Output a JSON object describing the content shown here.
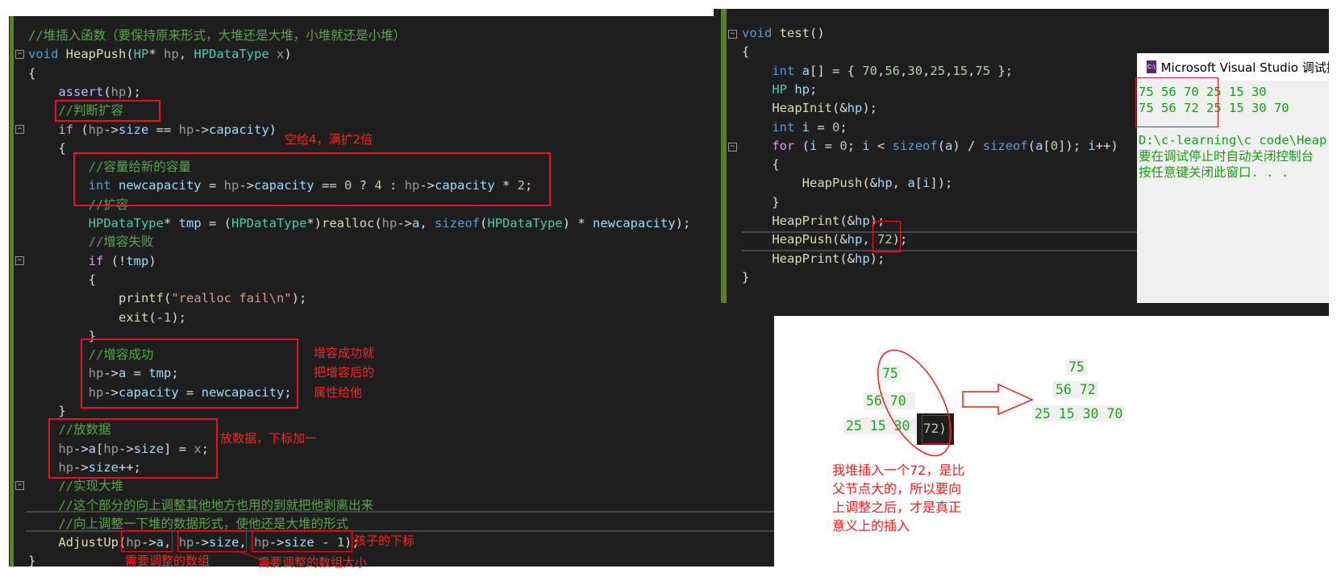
{
  "left_editor": {
    "lines": [
      [
        [
          "cm",
          "//堆插入函数（要保持原来形式，大堆还是大堆，小堆就还是小堆）"
        ]
      ],
      [
        [
          "kw",
          "void "
        ],
        [
          "fn",
          "HeapPush"
        ],
        [
          "pl",
          "("
        ],
        [
          "ty",
          "HP"
        ],
        [
          "pl",
          "* "
        ],
        [
          "pa",
          "hp"
        ],
        [
          "pl",
          ", "
        ],
        [
          "ty",
          "HPDataType "
        ],
        [
          "pa",
          "x"
        ],
        [
          "pl",
          ")"
        ]
      ],
      [
        [
          "pl",
          "{"
        ]
      ],
      [
        [
          "pl",
          "    "
        ],
        [
          "ma",
          "assert"
        ],
        [
          "pl",
          "("
        ],
        [
          "pa",
          "hp"
        ],
        [
          "pl",
          ");"
        ]
      ],
      [
        [
          "pl",
          "    "
        ],
        [
          "cm",
          "//判断扩容"
        ]
      ],
      [
        [
          "pl",
          "    "
        ],
        [
          "ct",
          "if "
        ],
        [
          "pl",
          "("
        ],
        [
          "pa",
          "hp"
        ],
        [
          "pl",
          "->"
        ],
        [
          "va",
          "size"
        ],
        [
          "pl",
          " == "
        ],
        [
          "pa",
          "hp"
        ],
        [
          "pl",
          "->"
        ],
        [
          "va",
          "capacity"
        ],
        [
          "pl",
          ")"
        ]
      ],
      [
        [
          "pl",
          "    {"
        ]
      ],
      [
        [
          "pl",
          "        "
        ],
        [
          "cm",
          "//容量给新的容量"
        ]
      ],
      [
        [
          "pl",
          "        "
        ],
        [
          "kw",
          "int "
        ],
        [
          "va",
          "newcapacity"
        ],
        [
          "pl",
          " = "
        ],
        [
          "pa",
          "hp"
        ],
        [
          "pl",
          "->"
        ],
        [
          "va",
          "capacity"
        ],
        [
          "pl",
          " == "
        ],
        [
          "nu",
          "0"
        ],
        [
          "pl",
          " ? "
        ],
        [
          "nu",
          "4"
        ],
        [
          "pl",
          " : "
        ],
        [
          "pa",
          "hp"
        ],
        [
          "pl",
          "->"
        ],
        [
          "va",
          "capacity"
        ],
        [
          "pl",
          " * "
        ],
        [
          "nu",
          "2"
        ],
        [
          "pl",
          ";"
        ]
      ],
      [
        [
          "pl",
          "        "
        ],
        [
          "cm",
          "//扩容"
        ]
      ],
      [
        [
          "pl",
          "        "
        ],
        [
          "ty",
          "HPDataType"
        ],
        [
          "pl",
          "* "
        ],
        [
          "va",
          "tmp"
        ],
        [
          "pl",
          " = ("
        ],
        [
          "ty",
          "HPDataType"
        ],
        [
          "pl",
          "*)"
        ],
        [
          "fn",
          "realloc"
        ],
        [
          "pl",
          "("
        ],
        [
          "pa",
          "hp"
        ],
        [
          "pl",
          "->"
        ],
        [
          "va",
          "a"
        ],
        [
          "pl",
          ", "
        ],
        [
          "kw",
          "sizeof"
        ],
        [
          "pl",
          "("
        ],
        [
          "ty",
          "HPDataType"
        ],
        [
          "pl",
          ") * "
        ],
        [
          "va",
          "newcapacity"
        ],
        [
          "pl",
          ");"
        ]
      ],
      [
        [
          "pl",
          "        "
        ],
        [
          "cm",
          "//增容失败"
        ]
      ],
      [
        [
          "pl",
          "        "
        ],
        [
          "ct",
          "if "
        ],
        [
          "pl",
          "(!"
        ],
        [
          "va",
          "tmp"
        ],
        [
          "pl",
          ")"
        ]
      ],
      [
        [
          "pl",
          "        {"
        ]
      ],
      [
        [
          "pl",
          "            "
        ],
        [
          "fn",
          "printf"
        ],
        [
          "pl",
          "("
        ],
        [
          "st",
          "\"realloc fail\\n\""
        ],
        [
          "pl",
          ");"
        ]
      ],
      [
        [
          "pl",
          "            "
        ],
        [
          "fn",
          "exit"
        ],
        [
          "pl",
          "(-"
        ],
        [
          "nu",
          "1"
        ],
        [
          "pl",
          ");"
        ]
      ],
      [
        [
          "pl",
          "        }"
        ]
      ],
      [
        [
          "pl",
          "        "
        ],
        [
          "cm",
          "//增容成功"
        ]
      ],
      [
        [
          "pl",
          "        "
        ],
        [
          "pa",
          "hp"
        ],
        [
          "pl",
          "->"
        ],
        [
          "va",
          "a"
        ],
        [
          "pl",
          " = "
        ],
        [
          "va",
          "tmp"
        ],
        [
          "pl",
          ";"
        ]
      ],
      [
        [
          "pl",
          "        "
        ],
        [
          "pa",
          "hp"
        ],
        [
          "pl",
          "->"
        ],
        [
          "va",
          "capacity"
        ],
        [
          "pl",
          " = "
        ],
        [
          "va",
          "newcapacity"
        ],
        [
          "pl",
          ";"
        ]
      ],
      [
        [
          "pl",
          "    }"
        ]
      ],
      [
        [
          "pl",
          "    "
        ],
        [
          "cm",
          "//放数据"
        ]
      ],
      [
        [
          "pl",
          "    "
        ],
        [
          "pa",
          "hp"
        ],
        [
          "pl",
          "->"
        ],
        [
          "va",
          "a"
        ],
        [
          "pl",
          "["
        ],
        [
          "pa",
          "hp"
        ],
        [
          "pl",
          "->"
        ],
        [
          "va",
          "size"
        ],
        [
          "pl",
          "] = "
        ],
        [
          "pa",
          "x"
        ],
        [
          "pl",
          ";"
        ]
      ],
      [
        [
          "pl",
          "    "
        ],
        [
          "pa",
          "hp"
        ],
        [
          "pl",
          "->"
        ],
        [
          "va",
          "size"
        ],
        [
          "pl",
          "++;"
        ]
      ],
      [
        [
          "pl",
          "    "
        ],
        [
          "cm",
          "//实现大堆"
        ]
      ],
      [
        [
          "pl",
          "    "
        ],
        [
          "cm",
          "//这个部分的向上调整其他地方也用的到就把他剥离出来"
        ]
      ],
      [
        [
          "pl",
          "    "
        ],
        [
          "cm",
          "//向上调整一下堆的数据形式，使他还是大堆的形式"
        ]
      ],
      [
        [
          "pl",
          "    "
        ],
        [
          "fn",
          "AdjustUp"
        ],
        [
          "pl",
          "("
        ],
        [
          "pa",
          "hp"
        ],
        [
          "pl",
          "->"
        ],
        [
          "va",
          "a"
        ],
        [
          "pl",
          ", "
        ],
        [
          "pa",
          "hp"
        ],
        [
          "pl",
          "->"
        ],
        [
          "va",
          "size"
        ],
        [
          "pl",
          ", "
        ],
        [
          "pa",
          "hp"
        ],
        [
          "pl",
          "->"
        ],
        [
          "va",
          "size"
        ],
        [
          "pl",
          " - "
        ],
        [
          "nu",
          "1"
        ],
        [
          "pl",
          ");"
        ]
      ],
      [
        [
          "pl",
          "}"
        ]
      ]
    ]
  },
  "right_editor": {
    "lines": [
      [
        [
          "kw",
          "void "
        ],
        [
          "fn",
          "test"
        ],
        [
          "pl",
          "()"
        ]
      ],
      [
        [
          "pl",
          "{"
        ]
      ],
      [
        [
          "pl",
          "    "
        ],
        [
          "kw",
          "int "
        ],
        [
          "va",
          "a"
        ],
        [
          "pl",
          "[] = { "
        ],
        [
          "nu",
          "70"
        ],
        [
          "pl",
          ","
        ],
        [
          "nu",
          "56"
        ],
        [
          "pl",
          ","
        ],
        [
          "nu",
          "30"
        ],
        [
          "pl",
          ","
        ],
        [
          "nu",
          "25"
        ],
        [
          "pl",
          ","
        ],
        [
          "nu",
          "15"
        ],
        [
          "pl",
          ","
        ],
        [
          "nu",
          "75"
        ],
        [
          "pl",
          " };"
        ]
      ],
      [
        [
          "pl",
          "    "
        ],
        [
          "ty",
          "HP "
        ],
        [
          "va",
          "hp"
        ],
        [
          "pl",
          ";"
        ]
      ],
      [
        [
          "pl",
          "    "
        ],
        [
          "fn",
          "HeapInit"
        ],
        [
          "pl",
          "(&"
        ],
        [
          "va",
          "hp"
        ],
        [
          "pl",
          ");"
        ]
      ],
      [
        [
          "pl",
          "    "
        ],
        [
          "kw",
          "int "
        ],
        [
          "va",
          "i"
        ],
        [
          "pl",
          " = "
        ],
        [
          "nu",
          "0"
        ],
        [
          "pl",
          ";"
        ]
      ],
      [
        [
          "pl",
          "    "
        ],
        [
          "ct",
          "for "
        ],
        [
          "pl",
          "("
        ],
        [
          "va",
          "i"
        ],
        [
          "pl",
          " = "
        ],
        [
          "nu",
          "0"
        ],
        [
          "pl",
          "; "
        ],
        [
          "va",
          "i"
        ],
        [
          "pl",
          " < "
        ],
        [
          "kw",
          "sizeof"
        ],
        [
          "pl",
          "("
        ],
        [
          "va",
          "a"
        ],
        [
          "pl",
          ") / "
        ],
        [
          "kw",
          "sizeof"
        ],
        [
          "pl",
          "("
        ],
        [
          "va",
          "a"
        ],
        [
          "pl",
          "["
        ],
        [
          "nu",
          "0"
        ],
        [
          "pl",
          "]); "
        ],
        [
          "va",
          "i"
        ],
        [
          "pl",
          "++)"
        ]
      ],
      [
        [
          "pl",
          "    {"
        ]
      ],
      [
        [
          "pl",
          "        "
        ],
        [
          "fn",
          "HeapPush"
        ],
        [
          "pl",
          "(&"
        ],
        [
          "va",
          "hp"
        ],
        [
          "pl",
          ", "
        ],
        [
          "va",
          "a"
        ],
        [
          "pl",
          "["
        ],
        [
          "va",
          "i"
        ],
        [
          "pl",
          "]);"
        ]
      ],
      [
        [
          "pl",
          "    }"
        ]
      ],
      [
        [
          "pl",
          "    "
        ],
        [
          "fn",
          "HeapPrint"
        ],
        [
          "pl",
          "(&"
        ],
        [
          "va",
          "hp"
        ],
        [
          "pl",
          ");"
        ]
      ],
      [
        [
          "pl",
          "    "
        ],
        [
          "fn",
          "HeapPush"
        ],
        [
          "pl",
          "(&"
        ],
        [
          "va",
          "hp"
        ],
        [
          "pl",
          ", "
        ],
        [
          "nu",
          "72"
        ],
        [
          "pl",
          ");"
        ]
      ],
      [
        [
          "pl",
          "    "
        ],
        [
          "fn",
          "HeapPrint"
        ],
        [
          "pl",
          "(&"
        ],
        [
          "va",
          "hp"
        ],
        [
          "pl",
          ");"
        ]
      ],
      [
        [
          "pl",
          "}"
        ]
      ]
    ]
  },
  "annotations": {
    "expand_rule": "空给4，满扩2倍",
    "assign_after_grow": [
      "增容成功就",
      "把增容后的",
      "属性给他"
    ],
    "put_data": "放数据，下标加一",
    "child_index": "孩子的下标",
    "array_to_adjust": "需要调整的数组",
    "array_size": "需要调整的数组大小"
  },
  "console": {
    "title": "Microsoft Visual Studio 调试控制台",
    "icon": "console-app-icon",
    "output": [
      "75 56 70 25 15 30",
      "75 56 72 25 15 30 70"
    ],
    "path_line": "D:\\c-learning\\c code\\Heap",
    "auto_close_hint": "要在调试停止时自动关闭控制台",
    "press_key_hint": "按任意键关闭此窗口. . ."
  },
  "diagram": {
    "before": {
      "row1": "75",
      "row2": "56 70",
      "row3": "25 15 30"
    },
    "inserted_snippet": "72)",
    "after": {
      "row1": "75",
      "row2": "56 72",
      "row3": "25 15 30 70"
    },
    "caption": [
      "我堆插入一个72，是比",
      "父节点大的，所以要向",
      "上调整之后，才是真正",
      "意义上的插入"
    ]
  },
  "colors": {
    "annotation_red": "#e81123",
    "console_green": "#13a10e",
    "editor_bg": "#1e1e1e"
  }
}
